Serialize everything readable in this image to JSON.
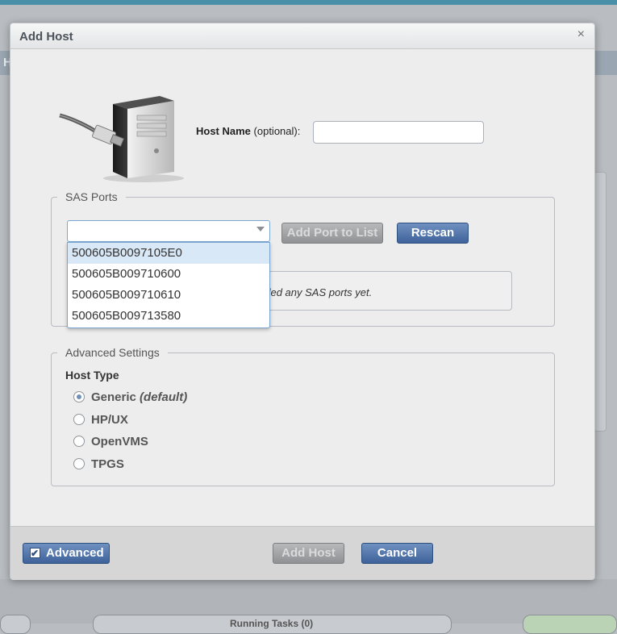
{
  "dialog": {
    "title": "Add Host",
    "close_icon": "×"
  },
  "host_name": {
    "label": "Host Name",
    "optional": " (optional):",
    "value": ""
  },
  "sas_ports": {
    "legend": "SAS Ports",
    "selected_value": "",
    "options": [
      "500605B0097105E0",
      "500605B009710600",
      "500605B009710610",
      "500605B009713580"
    ],
    "highlighted_index": 0,
    "add_port_button": "Add Port to List",
    "rescan_button": "Rescan",
    "empty_message": "dded any SAS ports yet."
  },
  "advanced": {
    "legend": "Advanced Settings",
    "host_type_label": "Host Type",
    "options": [
      {
        "label": "Generic",
        "suffix": "(default)",
        "selected": true
      },
      {
        "label": "HP/UX",
        "suffix": "",
        "selected": false
      },
      {
        "label": "OpenVMS",
        "suffix": "",
        "selected": false
      },
      {
        "label": "TPGS",
        "suffix": "",
        "selected": false
      }
    ]
  },
  "footer": {
    "advanced_toggle": "Advanced",
    "add_host_button": "Add Host",
    "cancel_button": "Cancel"
  },
  "background": {
    "strip_letter": "H",
    "running_tasks": "Running Tasks (0)"
  },
  "colors": {
    "accent_blue": "#3e629a",
    "dialog_bg": "#ededed"
  }
}
